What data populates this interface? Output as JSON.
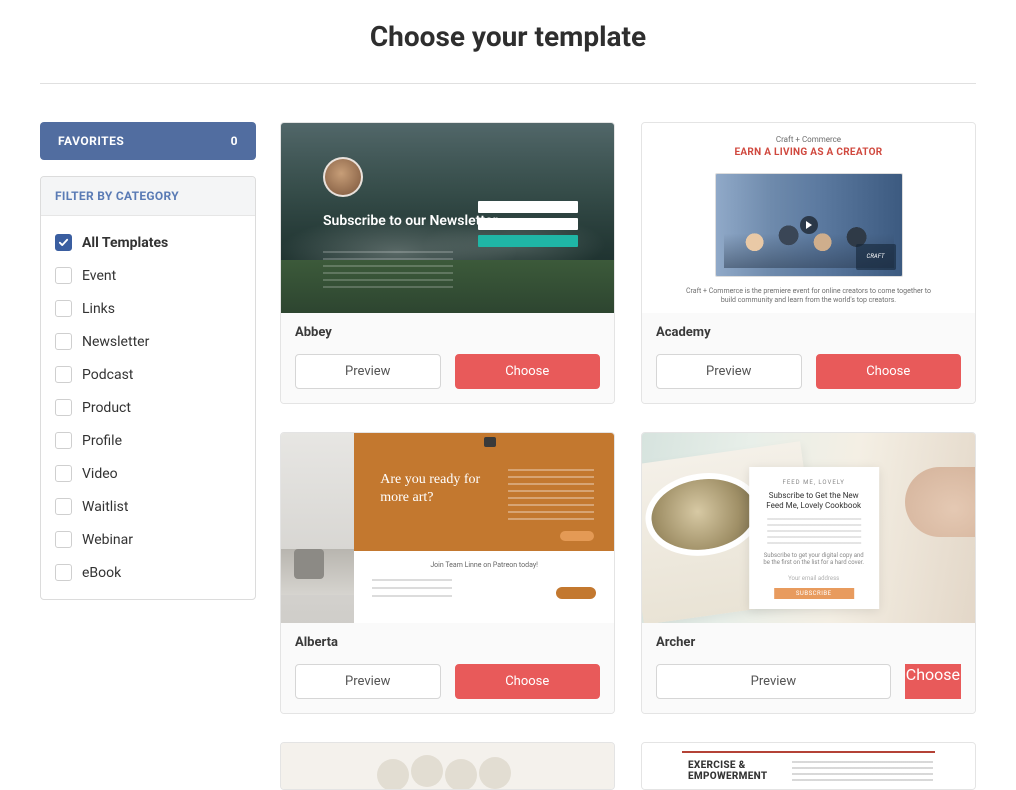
{
  "page": {
    "title": "Choose your template"
  },
  "sidebar": {
    "favorites": {
      "label": "FAVORITES",
      "count": "0"
    },
    "filter_header": "FILTER BY CATEGORY",
    "filters": [
      {
        "label": "All Templates",
        "checked": true
      },
      {
        "label": "Event",
        "checked": false
      },
      {
        "label": "Links",
        "checked": false
      },
      {
        "label": "Newsletter",
        "checked": false
      },
      {
        "label": "Podcast",
        "checked": false
      },
      {
        "label": "Product",
        "checked": false
      },
      {
        "label": "Profile",
        "checked": false
      },
      {
        "label": "Video",
        "checked": false
      },
      {
        "label": "Waitlist",
        "checked": false
      },
      {
        "label": "Webinar",
        "checked": false
      },
      {
        "label": "eBook",
        "checked": false
      }
    ]
  },
  "buttons": {
    "preview": "Preview",
    "choose": "Choose"
  },
  "templates": [
    {
      "name": "Abbey"
    },
    {
      "name": "Academy"
    },
    {
      "name": "Alberta"
    },
    {
      "name": "Archer"
    }
  ],
  "thumbs": {
    "abbey": {
      "headline": "Subscribe to our Newsletter"
    },
    "academy": {
      "kicker": "Craft + Commerce",
      "title": "EARN A LIVING AS A CREATOR",
      "badge": "CRAFT",
      "caption": "Craft + Commerce is the premiere event for online creators to come together to build community and learn from the world's top creators."
    },
    "alberta": {
      "headline": "Are you ready for more art?",
      "bar_title": "Join Team Linne on Patreon today!"
    },
    "archer": {
      "brand": "FEED ME, LOVELY",
      "headline": "Subscribe to Get the New Feed Me, Lovely Cookbook",
      "sub": "Subscribe to get your digital copy and be the first on the list for a hard cover.",
      "email_label": "Your email address",
      "cta": "SUBSCRIBE"
    },
    "partial_right": {
      "title_a": "EXERCISE &",
      "title_b": "EMPOWERMENT"
    }
  }
}
